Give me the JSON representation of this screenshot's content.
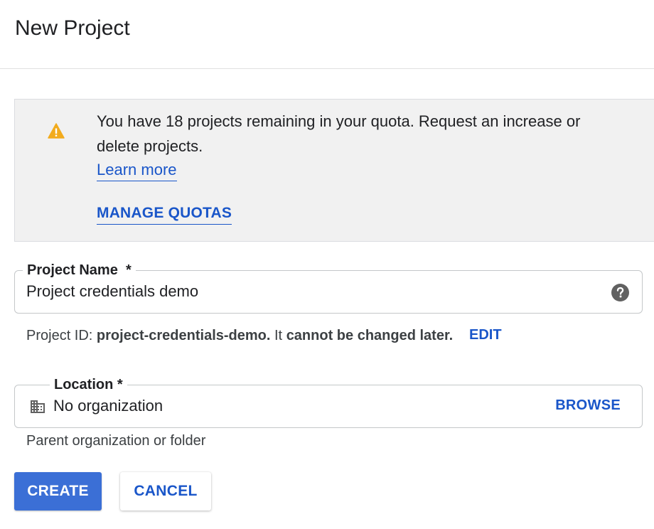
{
  "dialog": {
    "title": "New Project"
  },
  "notice": {
    "icon": "warning-icon",
    "icon_color": "#f2ab1d",
    "message": "You have 18 projects remaining in your quota. Request an increase or delete projects.",
    "learn_more": "Learn more",
    "manage_quotas": "MANAGE QUOTAS"
  },
  "project_name": {
    "label": "Project Name",
    "required_mark": "*",
    "value": "Project credentials demo",
    "help_icon": "help-icon"
  },
  "project_id": {
    "prefix": "Project ID:",
    "id": "project-credentials-demo.",
    "middle": "It",
    "suffix": "cannot be changed later.",
    "edit": "EDIT"
  },
  "location": {
    "label": "Location",
    "required_mark": "*",
    "value": "No organization",
    "icon": "building-icon",
    "browse": "BROWSE",
    "hint": "Parent organization or folder"
  },
  "actions": {
    "create": "CREATE",
    "cancel": "CANCEL"
  },
  "colors": {
    "accent": "#1a56c9",
    "primary_button": "#3b6fd6",
    "notice_background": "#f1f1f1"
  }
}
